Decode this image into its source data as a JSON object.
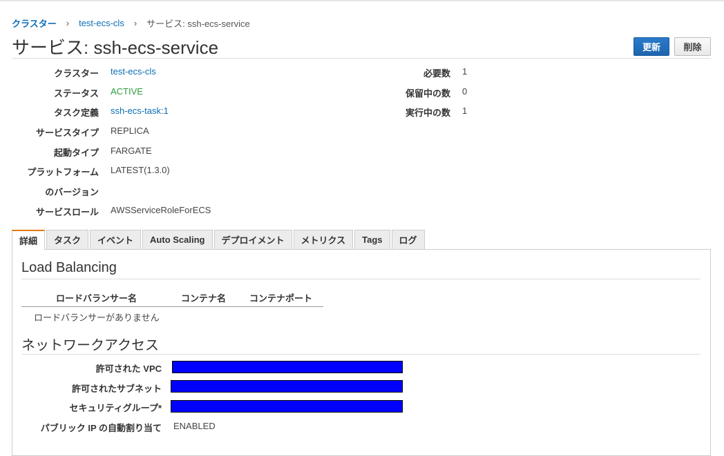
{
  "breadcrumb": {
    "root": "クラスター",
    "cluster": "test-ecs-cls",
    "current": "サービス: ssh-ecs-service"
  },
  "page": {
    "title": "サービス: ssh-ecs-service"
  },
  "actions": {
    "update_label": "更新",
    "delete_label": "削除"
  },
  "details_left": [
    {
      "label": "クラスター",
      "value": "test-ecs-cls",
      "style": "link"
    },
    {
      "label": "ステータス",
      "value": "ACTIVE",
      "style": "status"
    },
    {
      "label": "タスク定義",
      "value": "ssh-ecs-task:1",
      "style": "link"
    },
    {
      "label": "サービスタイプ",
      "value": "REPLICA",
      "style": "text"
    },
    {
      "label": "起動タイプ",
      "value": "FARGATE",
      "style": "text"
    },
    {
      "label": "プラットフォーム",
      "value": "LATEST(1.3.0)",
      "style": "text"
    },
    {
      "label": "のバージョン",
      "value": "",
      "style": "text"
    },
    {
      "label": "サービスロール",
      "value": "AWSServiceRoleForECS",
      "style": "text"
    }
  ],
  "details_right": [
    {
      "label": "必要数",
      "value": "1"
    },
    {
      "label": "保留中の数",
      "value": "0"
    },
    {
      "label": "実行中の数",
      "value": "1"
    }
  ],
  "tabs": [
    "詳細",
    "タスク",
    "イベント",
    "Auto Scaling",
    "デプロイメント",
    "メトリクス",
    "Tags",
    "ログ"
  ],
  "active_tab": "詳細",
  "load_balancing": {
    "title": "Load Balancing",
    "columns": [
      "ロードバランサー名",
      "コンテナ名",
      "コンテナポート"
    ],
    "empty_message": "ロードバランサーがありません"
  },
  "network": {
    "title": "ネットワークアクセス",
    "rows": [
      {
        "label": "許可された VPC",
        "value": "",
        "redacted": true
      },
      {
        "label": "許可されたサブネット",
        "value": "",
        "redacted": true
      },
      {
        "label": "セキュリティグループ*",
        "value": "",
        "redacted": true
      },
      {
        "label": "パブリック IP の自動割り当て",
        "value": "ENABLED",
        "redacted": false
      }
    ]
  },
  "colors": {
    "accent": "#1f6bb8",
    "link": "#0a6fb5",
    "status_active": "#2a9d3a",
    "tab_active_top": "#e47911",
    "redaction": "#0000ff"
  }
}
